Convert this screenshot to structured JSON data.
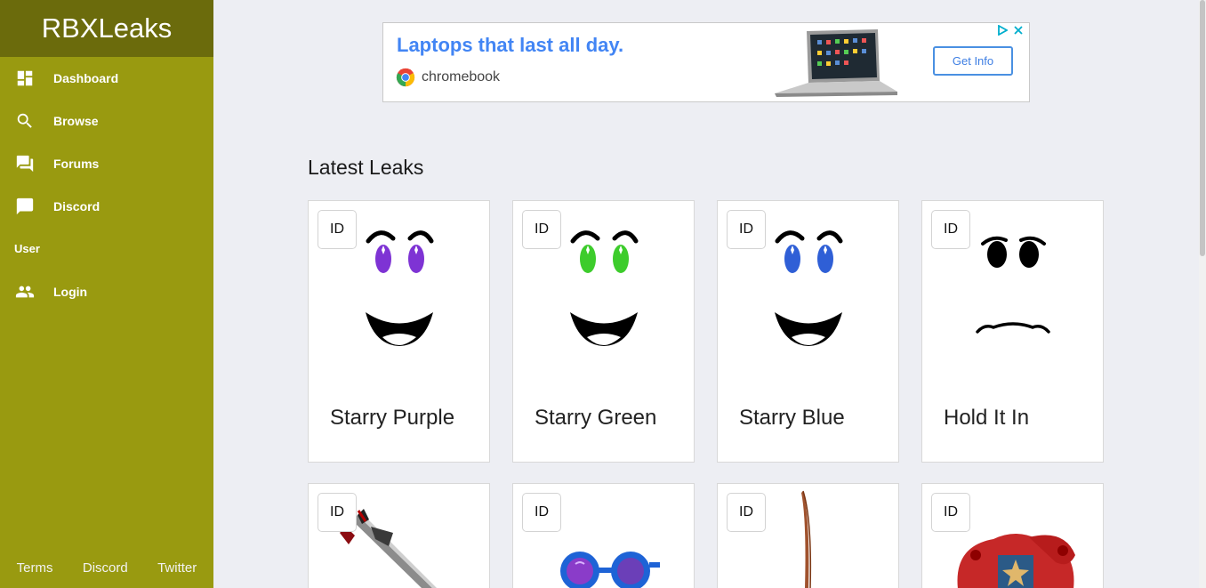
{
  "sidebar": {
    "brand": "RBXLeaks",
    "nav": [
      {
        "label": "Dashboard",
        "icon": "dashboard-icon"
      },
      {
        "label": "Browse",
        "icon": "search-icon"
      },
      {
        "label": "Forums",
        "icon": "forum-icon"
      },
      {
        "label": "Discord",
        "icon": "chat-icon"
      }
    ],
    "user_section": "User",
    "login": {
      "label": "Login",
      "icon": "people-icon"
    },
    "footer": [
      "Terms",
      "Discord",
      "Twitter"
    ]
  },
  "ad": {
    "headline": "Laptops that last all day.",
    "brand": "chromebook",
    "cta": "Get Info"
  },
  "main": {
    "section_title": "Latest Leaks",
    "id_label": "ID",
    "items": [
      {
        "title": "Starry Purple",
        "thumb": "face-starry-purple"
      },
      {
        "title": "Starry Green",
        "thumb": "face-starry-green"
      },
      {
        "title": "Starry Blue",
        "thumb": "face-starry-blue"
      },
      {
        "title": "Hold It In",
        "thumb": "face-hold-it-in"
      },
      {
        "title": "",
        "thumb": "sword"
      },
      {
        "title": "",
        "thumb": "blue-goggles"
      },
      {
        "title": "",
        "thumb": "katana"
      },
      {
        "title": "",
        "thumb": "red-hat"
      }
    ]
  },
  "colors": {
    "sidebar": "#999a10",
    "brand_bar": "#6b6b0c",
    "background": "#edeef3",
    "ad_blue": "#4285f4"
  }
}
